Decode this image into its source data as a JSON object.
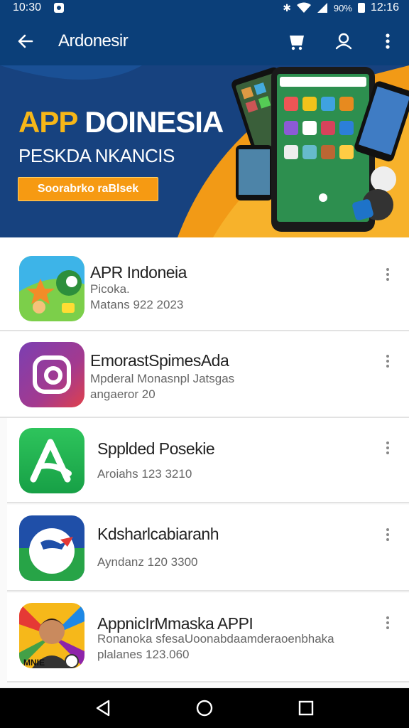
{
  "status_bar": {
    "time": "10:30",
    "battery_pct": "90%",
    "clock_right": "12:16",
    "icons": [
      "notification-icon",
      "bluetooth-icon",
      "wifi-icon",
      "signal-icon",
      "battery-icon"
    ]
  },
  "app_bar": {
    "title": "Ardonesir",
    "icons": [
      "back-arrow-icon",
      "cart-icon",
      "account-icon",
      "more-vert-icon"
    ],
    "color": "#0b3f79"
  },
  "banner": {
    "title_part1": "APP",
    "title_part2": "DOINESIA",
    "subtitle": "PESKDA NKANCIS",
    "button_label": "Soorabrko raBlsek",
    "accent": "#f69a12"
  },
  "apps": [
    {
      "name": "APR Indoneia",
      "line1": "Picoka.",
      "line2": "Matans 922 2023",
      "icon": "app-icon-colorful"
    },
    {
      "name": "EmorastSpimesAda",
      "line1": "Mpderal Monasnpl Jatsgas",
      "line2": "angaeror 20",
      "icon": "app-icon-instagram-like"
    },
    {
      "name": "Spplded Posekie",
      "line1": "Aroiahs 123 3210",
      "line2": "",
      "icon": "app-icon-letter-a"
    },
    {
      "name": "Kdsharlcabiaranh",
      "line1": "Ayndanz 120 3300",
      "line2": "",
      "icon": "app-icon-globe"
    },
    {
      "name": "AppnicIrMmaska APPI",
      "line1": "Ronanoka sfesaUoonabdaamderaoenbhaka",
      "line2": "plalanes 123.060",
      "icon": "app-icon-portrait"
    }
  ],
  "nav_bar": {
    "icons": [
      "back-triangle-icon",
      "home-circle-icon",
      "recents-square-icon"
    ]
  }
}
